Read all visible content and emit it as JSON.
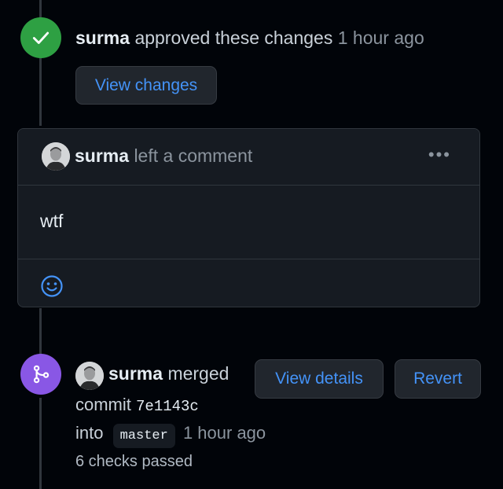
{
  "approved_event": {
    "author": "surma",
    "action": "approved these changes",
    "time": "1 hour ago",
    "view_changes_label": "View changes",
    "colors": {
      "badge": "#2ea043"
    },
    "icon": "check-icon"
  },
  "comment": {
    "author": "surma",
    "action": "left a comment",
    "body": "wtf",
    "menu_icon": "kebab-horizontal-icon",
    "reaction_icon": "smiley-icon"
  },
  "merge_event": {
    "author": "surma",
    "action": "merged",
    "commit_label": "commit",
    "commit_sha": "7e1143c",
    "into_label": "into",
    "branch": "master",
    "time": "1 hour ago",
    "checks": "6 checks passed",
    "view_details_label": "View details",
    "revert_label": "Revert",
    "colors": {
      "badge": "#8957e5"
    },
    "icon": "git-merge-icon"
  },
  "colors": {
    "background": "#010409",
    "link": "#4493f8",
    "muted": "#8b949e"
  }
}
